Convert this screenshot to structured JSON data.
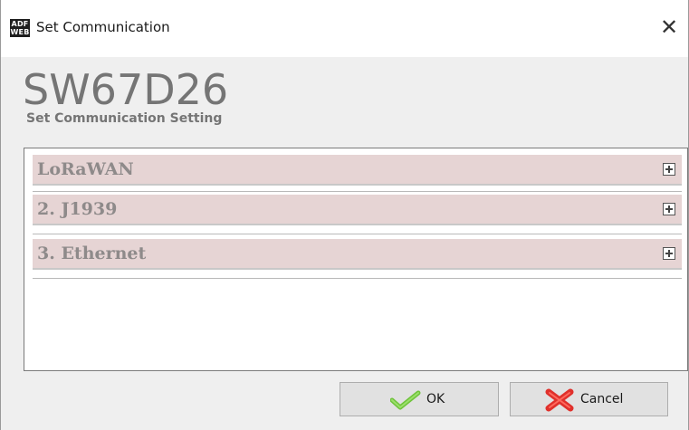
{
  "window": {
    "title": "Set Communication",
    "icon_text_top": "ADF",
    "icon_text_bottom": "WEB",
    "close_symbol": "✕"
  },
  "header": {
    "device_name": "SW67D26",
    "subtitle": "Set Communication Setting"
  },
  "sections": [
    {
      "label": "LoRaWAN",
      "icon": "expand-plus-icon"
    },
    {
      "label": "2. J1939",
      "icon": "expand-plus-icon"
    },
    {
      "label": "3. Ethernet",
      "icon": "expand-plus-icon"
    }
  ],
  "buttons": {
    "ok_label": "OK",
    "ok_icon": "checkmark-icon",
    "cancel_label": "Cancel",
    "cancel_icon": "red-x-icon"
  },
  "colors": {
    "section_bg": "#e6d4d4",
    "section_text": "#8e8a8a",
    "ok_check": "#6fc33b",
    "cancel_x": "#e0302b"
  }
}
